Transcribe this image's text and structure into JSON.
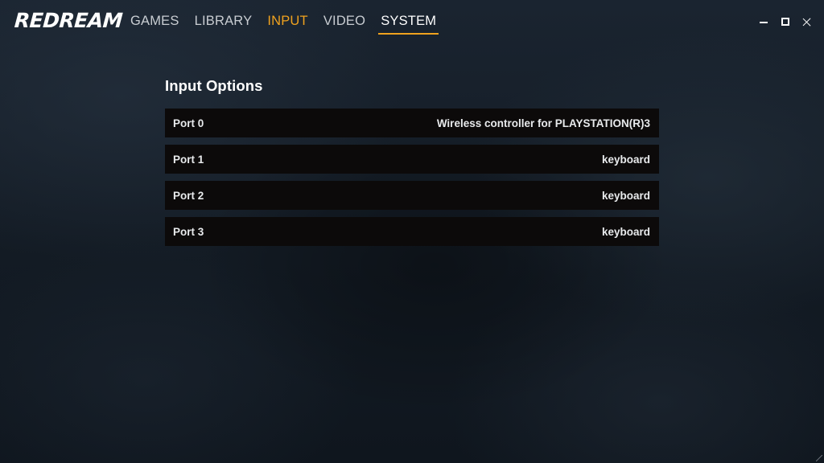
{
  "app": {
    "logo": "REDREAM"
  },
  "nav": {
    "items": [
      {
        "label": "GAMES"
      },
      {
        "label": "LIBRARY"
      },
      {
        "label": "INPUT"
      },
      {
        "label": "VIDEO"
      },
      {
        "label": "SYSTEM"
      }
    ],
    "active": "SYSTEM",
    "hover": "INPUT"
  },
  "window_controls": {
    "icons": [
      "minimize-icon",
      "maximize-icon",
      "close-icon"
    ]
  },
  "panel": {
    "title": "Input Options",
    "options": [
      {
        "label": "Port 0",
        "value": "Wireless controller for PLAYSTATION(R)3"
      },
      {
        "label": "Port 1",
        "value": "keyboard"
      },
      {
        "label": "Port 2",
        "value": "keyboard"
      },
      {
        "label": "Port 3",
        "value": "keyboard"
      }
    ]
  },
  "colors": {
    "accent": "#f0a21e",
    "row_background": "#0c0a0a",
    "nav_text": "#c9cdd2"
  }
}
